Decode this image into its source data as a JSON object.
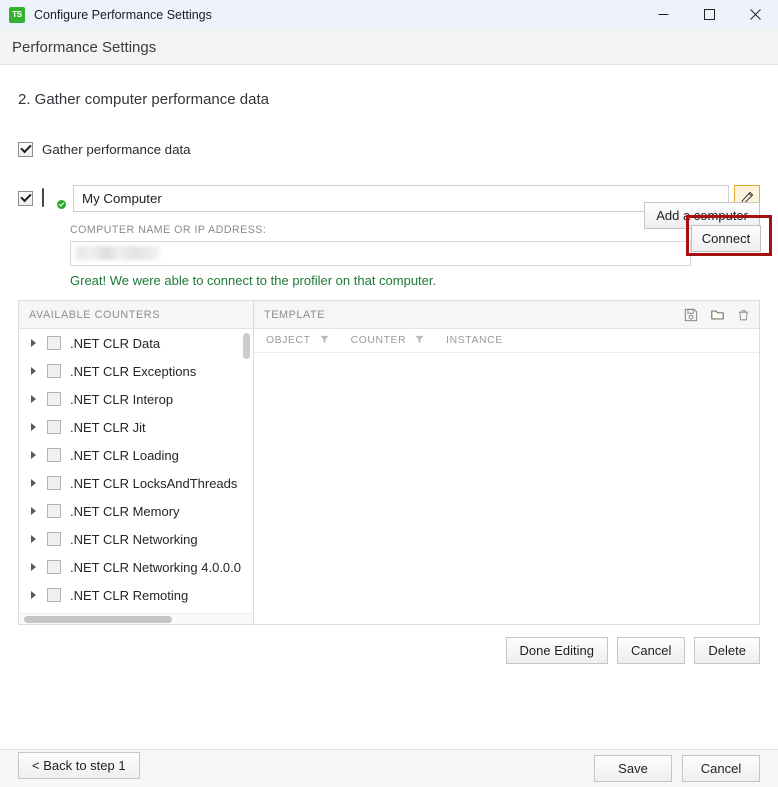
{
  "window": {
    "title": "Configure Performance Settings",
    "app_icon": "TS",
    "controls": {
      "minimize": "minimize-icon",
      "maximize": "maximize-icon",
      "close": "close-icon"
    }
  },
  "header": {
    "title": "Performance Settings"
  },
  "main": {
    "step_title": "2. Gather computer performance data",
    "gather_checkbox": {
      "label": "Gather performance data",
      "checked": true
    },
    "add_computer_button": "Add a computer",
    "computer": {
      "enabled_checkbox": true,
      "icon": "computer-monitor-connected-icon",
      "name_value": "My Computer",
      "edit_button_icon": "pencil-icon"
    },
    "details": {
      "ip_label": "COMPUTER NAME OR IP ADDRESS:",
      "ip_value": "",
      "ip_redacted": true,
      "connect_button": "Connect",
      "connect_highlight_color": "#a51111",
      "success_message": "Great! We were able to connect to the profiler on that computer.",
      "success_color": "#1d7a37"
    },
    "available_counters": {
      "header": "AVAILABLE COUNTERS",
      "items": [
        {
          "label": ".NET CLR Data",
          "checked": false,
          "expanded": false
        },
        {
          "label": ".NET CLR Exceptions",
          "checked": false,
          "expanded": false
        },
        {
          "label": ".NET CLR Interop",
          "checked": false,
          "expanded": false
        },
        {
          "label": ".NET CLR Jit",
          "checked": false,
          "expanded": false
        },
        {
          "label": ".NET CLR Loading",
          "checked": false,
          "expanded": false
        },
        {
          "label": ".NET CLR LocksAndThreads",
          "checked": false,
          "expanded": false
        },
        {
          "label": ".NET CLR Memory",
          "checked": false,
          "expanded": false
        },
        {
          "label": ".NET CLR Networking",
          "checked": false,
          "expanded": false
        },
        {
          "label": ".NET CLR Networking 4.0.0.0",
          "checked": false,
          "expanded": false
        },
        {
          "label": ".NET CLR Remoting",
          "checked": false,
          "expanded": false
        }
      ]
    },
    "template": {
      "header": "TEMPLATE",
      "toolbar": [
        {
          "name": "save-template-icon",
          "title": "Save"
        },
        {
          "name": "open-template-icon",
          "title": "Open"
        },
        {
          "name": "delete-template-icon",
          "title": "Delete"
        }
      ],
      "columns": [
        {
          "label": "OBJECT",
          "filter": true
        },
        {
          "label": "COUNTER",
          "filter": true
        },
        {
          "label": "INSTANCE",
          "filter": false
        }
      ],
      "rows": []
    },
    "edit_actions": {
      "done": "Done Editing",
      "cancel": "Cancel",
      "delete": "Delete"
    },
    "back_button": "< Back to step 1"
  },
  "footer": {
    "save": "Save",
    "cancel": "Cancel"
  }
}
